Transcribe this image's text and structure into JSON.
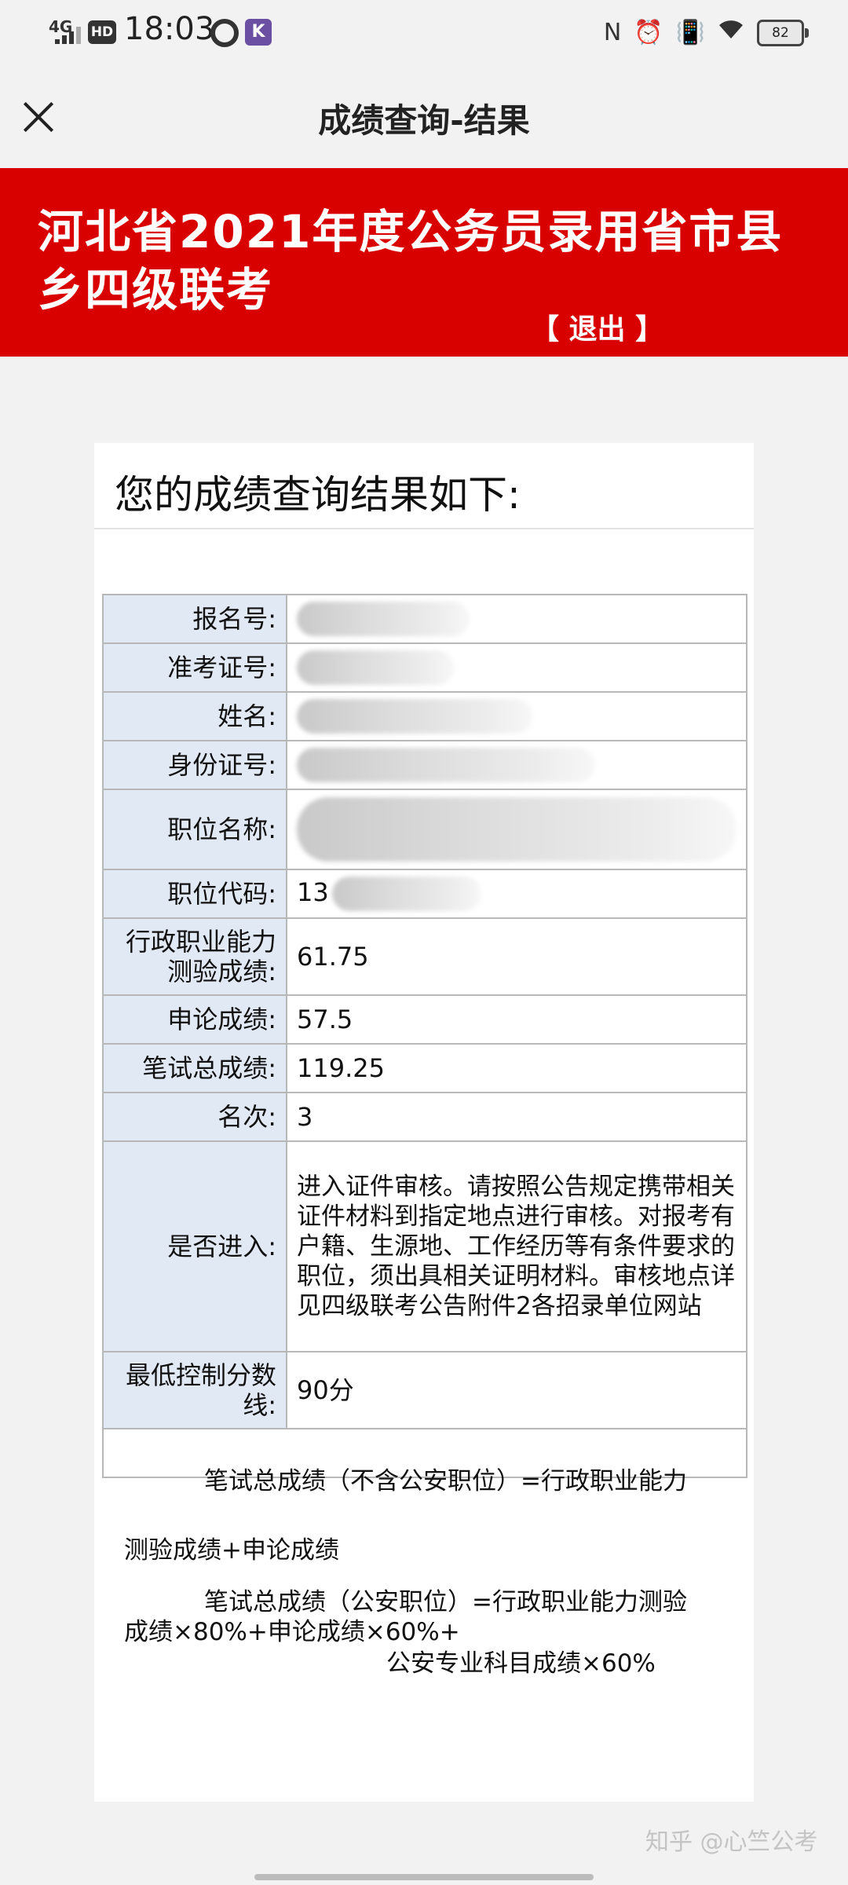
{
  "status_bar": {
    "network": "4G",
    "hd": "HD",
    "time": "18:03",
    "app_badge": "K",
    "nfc": "N",
    "battery": "82"
  },
  "app_bar": {
    "title": "成绩查询-结果"
  },
  "banner": {
    "title": "河北省2021年度公务员录用省市县乡四级联考",
    "exit": "【 退出 】"
  },
  "card": {
    "heading": "您的成绩查询结果如下:"
  },
  "results": {
    "registration_no_label": "报名号:",
    "admission_no_label": "准考证号:",
    "name_label": "姓名:",
    "id_no_label": "身份证号:",
    "position_name_label": "职位名称:",
    "position_code_label": "职位代码:",
    "position_code_value": "13",
    "xingce_label": "行政职业能力测验成绩:",
    "xingce_value": "61.75",
    "shenlun_label": "申论成绩:",
    "shenlun_value": "57.5",
    "total_label": "笔试总成绩:",
    "total_value": "119.25",
    "rank_label": "名次:",
    "rank_value": "3",
    "advance_label": "是否进入:",
    "advance_value": "进入证件审核。请按照公告规定携带相关证件材料到指定地点进行审核。对报考有户籍、生源地、工作经历等有条件要求的职位，须出具相关证明材料。审核地点详见四级联考公告附件2各招录单位网站",
    "min_score_label": "最低控制分数线:",
    "min_score_value": "90分"
  },
  "formula": {
    "line1": "笔试总成绩（不含公安职位）=行政职业能力",
    "line2": "测验成绩+申论成绩",
    "line3": "笔试总成绩（公安职位）=行政职业能力测验",
    "line4": "成绩×80%+申论成绩×60%+",
    "line5": "公安专业科目成绩×60%"
  },
  "watermark": "知乎 @心竺公考"
}
